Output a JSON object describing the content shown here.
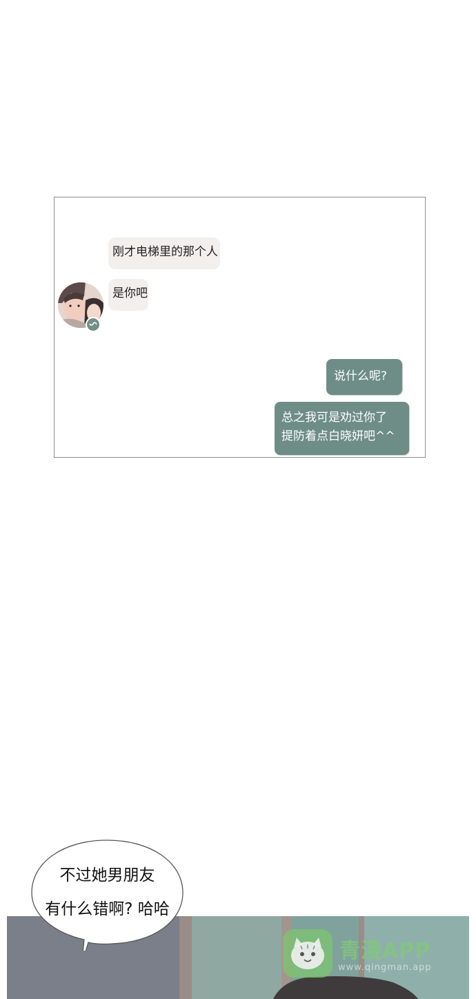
{
  "chat": {
    "incoming": [
      "刚才电梯里的那个人",
      "是你吧"
    ],
    "outgoing": [
      "说什么呢?",
      "总之我可是劝过你了",
      "提防着点白晓妍吧^^"
    ]
  },
  "speech": {
    "line1": "不过她男朋友",
    "line2": "有什么错啊? 哈哈"
  },
  "watermark": {
    "title": "青漫APP",
    "url": "www.qingman.app"
  },
  "colors": {
    "incoming_bubble": "#f3efed",
    "outgoing_bubble": "#6e8d87",
    "panel_border": "#8c8c8c",
    "watermark_green": "#7cc46f"
  }
}
